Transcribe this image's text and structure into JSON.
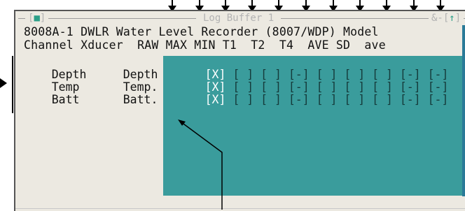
{
  "window": {
    "title": "Log Buffer 1",
    "close_glyph": "[•]",
    "controls_prefix": "&-[",
    "controls_up": "↑",
    "controls_suffix": "]"
  },
  "header": {
    "device": "8008A-1 DWLR Water Level Recorder (8007/WDP) Model",
    "columns": "Channel Xducer  RAW MAX MIN T1  T2  T4  AVE SD  ave"
  },
  "rows": [
    {
      "channel": "Depth",
      "xducer": "Depth",
      "cells": [
        "[X]",
        "[ ]",
        "[ ]",
        "[-]",
        "[ ]",
        "[ ]",
        "[ ]",
        "[-]",
        "[-]"
      ]
    },
    {
      "channel": "Temp",
      "xducer": "Temp.",
      "cells": [
        "[X]",
        "[ ]",
        "[ ]",
        "[-]",
        "[ ]",
        "[ ]",
        "[ ]",
        "[-]",
        "[-]"
      ]
    },
    {
      "channel": "Batt",
      "xducer": "Batt.",
      "cells": [
        "[X]",
        "[ ]",
        "[ ]",
        "[-]",
        "[ ]",
        "[ ]",
        "[ ]",
        "[-]",
        "[-]"
      ]
    }
  ],
  "colors": {
    "window_bg": "#ece9e1",
    "grid_bg": "#3a9c9c",
    "accent": "#2c9f88"
  }
}
